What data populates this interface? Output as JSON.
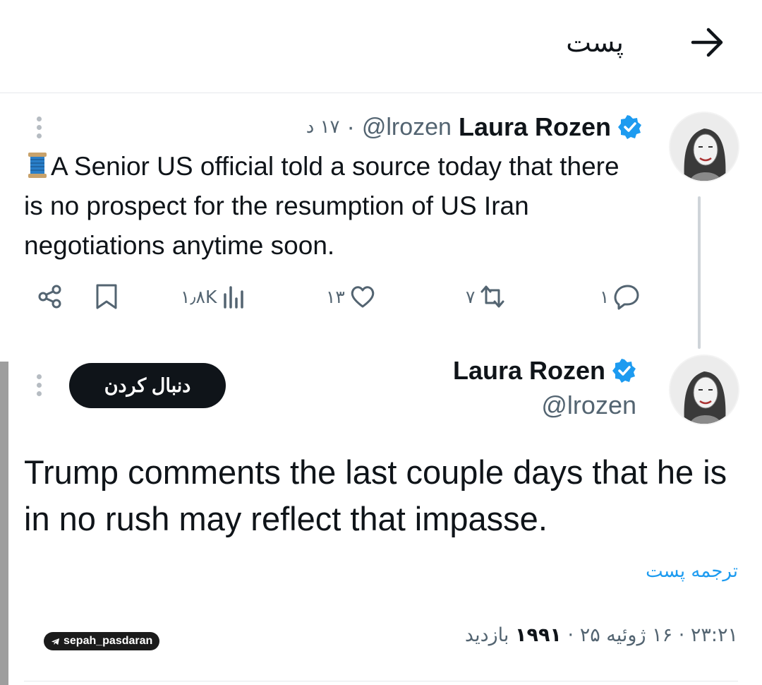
{
  "header": {
    "title": "پست",
    "back_icon": "arrow-right-icon"
  },
  "thread": {
    "parent_tweet": {
      "author_name": "Laura Rozen",
      "author_handle": "@lrozen",
      "separator": "·",
      "time_ago": "۱۷ د",
      "emoji_icon": "spool-of-thread-icon",
      "text": "A Senior US official told a source today that there is no prospect for the resumption of US Iran negotiations anytime soon.",
      "actions": {
        "reply_count": "۱",
        "retweet_count": "۷",
        "like_count": "۱۳",
        "views_count": "۱٫۸K"
      }
    },
    "main_tweet": {
      "author_name": "Laura Rozen",
      "author_handle": "@lrozen",
      "follow_label": "دنبال کردن",
      "text": "Trump comments the last couple days that he is in no rush may reflect that impasse.",
      "translate_label": "ترجمه پست",
      "time": "۲۳:۲۱",
      "date": "۱۶ ژوئیه ۲۵",
      "views_count": "۱۹۹۱",
      "views_label": "بازدید",
      "separator": "·"
    }
  },
  "watermark": {
    "text": "sepah_pasdaran"
  },
  "colors": {
    "accent": "#1d9bf0",
    "text": "#0f1419",
    "secondary": "#536471"
  }
}
